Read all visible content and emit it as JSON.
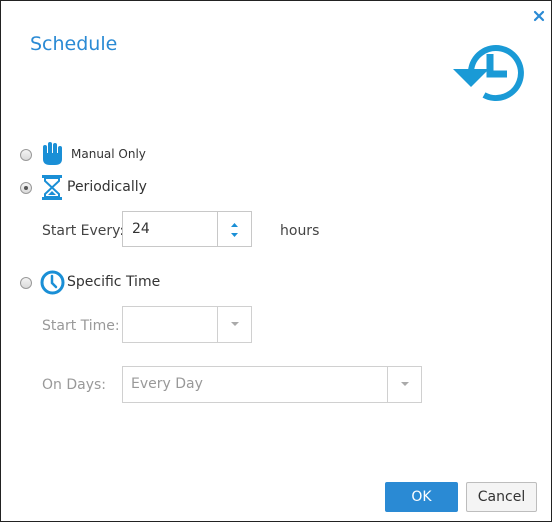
{
  "dialog": {
    "title": "Schedule",
    "icons": {
      "close": "close-icon",
      "header": "history-clock-icon"
    }
  },
  "schedule_options": [
    {
      "label": "Manual Only",
      "icon": "hand-icon",
      "selected": false
    },
    {
      "label": "Periodically",
      "icon": "hourglass-icon",
      "selected": true
    },
    {
      "label": "Specific Time",
      "icon": "clock-icon",
      "selected": false
    }
  ],
  "periodic": {
    "start_every_label": "Start Every:",
    "start_every_value": "24",
    "units": "hours"
  },
  "specific": {
    "start_time_label": "Start Time:",
    "start_time_value": "",
    "on_days_label": "On Days:",
    "on_days_value": "Every Day"
  },
  "buttons": {
    "ok": "OK",
    "cancel": "Cancel"
  },
  "colors": {
    "accent": "#2a8ad4",
    "disabled_text": "#999999",
    "border": "#222222"
  }
}
